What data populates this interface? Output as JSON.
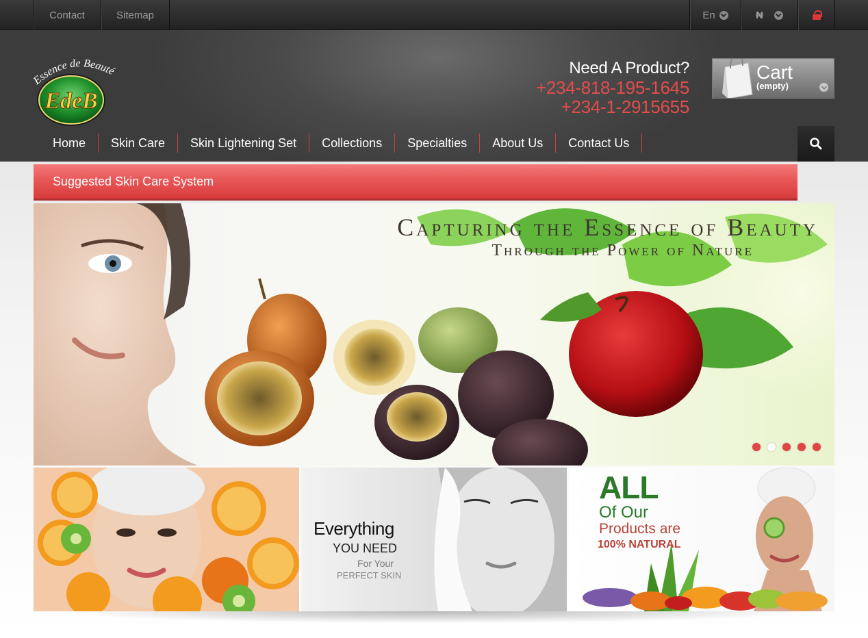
{
  "topbar": {
    "links": [
      "Contact",
      "Sitemap"
    ],
    "language": "En",
    "currency": "₦"
  },
  "header": {
    "logo_text_top": "Essence de Beauté",
    "logo_monogram": "EdeB",
    "need_product": "Need A Product?",
    "phone1": "+234-818-195-1645",
    "phone2": "+234-1-2915655",
    "cart_title": "Cart",
    "cart_status": "(empty)"
  },
  "nav": {
    "items": [
      "Home",
      "Skin Care",
      "Skin Lightening Set",
      "Collections",
      "Specialties",
      "About Us",
      "Contact Us"
    ]
  },
  "suggested": {
    "label": "Suggested Skin Care System"
  },
  "hero": {
    "title": "Capturing the Essence of Beauty",
    "subtitle": "Through the Power of Nature",
    "slide_count": 5,
    "active_slide": 2
  },
  "tiles": {
    "tile2": {
      "line1": "Everything",
      "line2": "YOU NEED",
      "line3": "For Your",
      "line4": "PERFECT SKIN"
    },
    "tile3": {
      "line1": "ALL",
      "line2": "Of Our",
      "line3": "Products are",
      "line4": "100% NATURAL"
    }
  },
  "colors": {
    "accent_red": "#e24c4c",
    "dark_header": "#3c3c3c",
    "brand_green": "#2a7a2a"
  },
  "icons": [
    "chevron-down-icon",
    "lock-icon",
    "shopping-bag-icon",
    "search-icon"
  ]
}
